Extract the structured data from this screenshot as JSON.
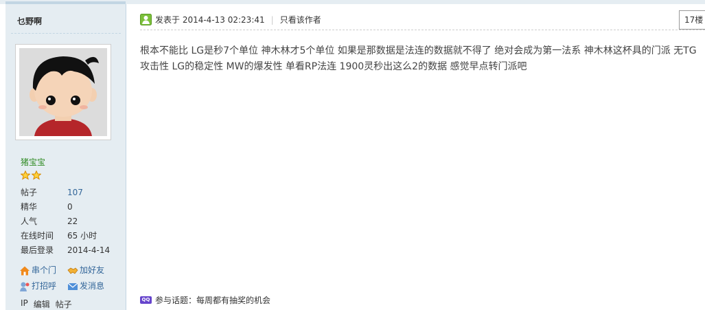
{
  "colors": {
    "sidebar_bg": "#e5edf2",
    "link": "#336699",
    "group": "#2f8a23",
    "topic_icon": "#6644cc"
  },
  "user": {
    "name": "乜野啊",
    "group": "猪宝宝",
    "star_count": 2,
    "stats": [
      {
        "label": "帖子",
        "value": "107"
      },
      {
        "label": "精华",
        "value": "0"
      },
      {
        "label": "人气",
        "value": "22"
      },
      {
        "label": "在线时间",
        "value": "65 小时"
      },
      {
        "label": "最后登录",
        "value": "2014-4-14"
      }
    ],
    "actions": [
      {
        "label": "串个门",
        "icon": "home-icon"
      },
      {
        "label": "加好友",
        "icon": "handshake-icon"
      },
      {
        "label": "打招呼",
        "icon": "greet-icon"
      },
      {
        "label": "发消息",
        "icon": "mail-icon"
      }
    ],
    "admin_links": [
      "IP",
      "编辑",
      "帖子"
    ]
  },
  "post": {
    "posted_at": "发表于 2014-4-13 02:23:41",
    "author_only": "只看该作者",
    "floor": "17楼",
    "body": "根本不能比  LG是秒7个单位 神木林才5个单位 如果是那数据是法连的数据就不得了 绝对会成为第一法系  神木林这杯具的门派  无TG攻击性  LG的稳定性 MW的爆发性  单看RP法连  1900灵秒出这么2的数据  感觉早点转门派吧",
    "topic": "参与话题：每周都有抽奖的机会",
    "topic_icon_text": "QQ"
  }
}
